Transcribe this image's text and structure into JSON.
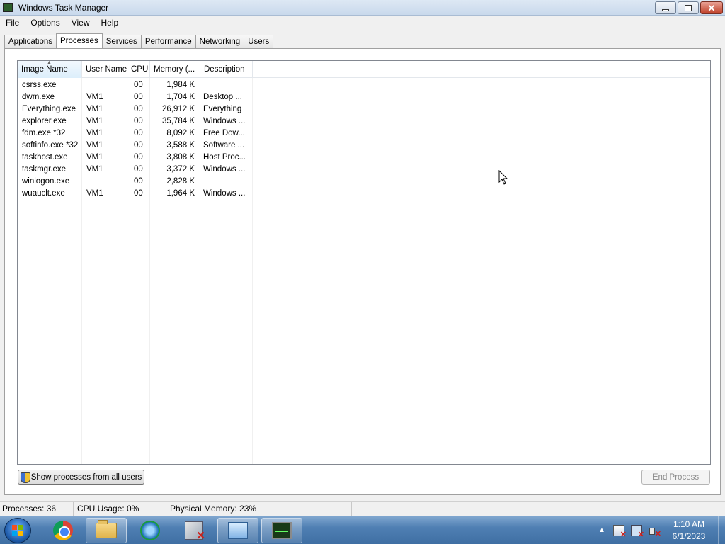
{
  "window": {
    "title": "Windows Task Manager",
    "caption_buttons": {
      "minimize": "",
      "maximize": "",
      "close": "✕"
    }
  },
  "menu": {
    "items": [
      {
        "label": "File"
      },
      {
        "label": "Options"
      },
      {
        "label": "View"
      },
      {
        "label": "Help"
      }
    ]
  },
  "tabs": [
    {
      "label": "Applications",
      "active": false
    },
    {
      "label": "Processes",
      "active": true
    },
    {
      "label": "Services",
      "active": false
    },
    {
      "label": "Performance",
      "active": false
    },
    {
      "label": "Networking",
      "active": false
    },
    {
      "label": "Users",
      "active": false
    }
  ],
  "process_table": {
    "columns": [
      "Image Name",
      "User Name",
      "CPU",
      "Memory (...",
      "Description"
    ],
    "rows": [
      {
        "image": "csrss.exe",
        "user": "",
        "cpu": "00",
        "memory": "1,984 K",
        "description": ""
      },
      {
        "image": "dwm.exe",
        "user": "VM1",
        "cpu": "00",
        "memory": "1,704 K",
        "description": "Desktop ..."
      },
      {
        "image": "Everything.exe",
        "user": "VM1",
        "cpu": "00",
        "memory": "26,912 K",
        "description": "Everything"
      },
      {
        "image": "explorer.exe",
        "user": "VM1",
        "cpu": "00",
        "memory": "35,784 K",
        "description": "Windows ..."
      },
      {
        "image": "fdm.exe *32",
        "user": "VM1",
        "cpu": "00",
        "memory": "8,092 K",
        "description": "Free Dow..."
      },
      {
        "image": "softinfo.exe *32",
        "user": "VM1",
        "cpu": "00",
        "memory": "3,588 K",
        "description": "Software ..."
      },
      {
        "image": "taskhost.exe",
        "user": "VM1",
        "cpu": "00",
        "memory": "3,808 K",
        "description": "Host Proc..."
      },
      {
        "image": "taskmgr.exe",
        "user": "VM1",
        "cpu": "00",
        "memory": "3,372 K",
        "description": "Windows ..."
      },
      {
        "image": "winlogon.exe",
        "user": "",
        "cpu": "00",
        "memory": "2,828 K",
        "description": ""
      },
      {
        "image": "wuauclt.exe",
        "user": "VM1",
        "cpu": "00",
        "memory": "1,964 K",
        "description": "Windows ..."
      }
    ]
  },
  "buttons": {
    "show_all": "Show processes from all users",
    "end_process": "End Process"
  },
  "status": {
    "processes": "Processes: 36",
    "cpu_usage": "CPU Usage: 0%",
    "physical_memory": "Physical Memory: 23%"
  },
  "taskbar": {
    "icons": [
      "windows-logo-icon",
      "chrome-icon",
      "folder-icon",
      "sync-icon",
      "tool-icon",
      "remote-desktop-icon",
      "task-manager-icon"
    ],
    "tray_icons": [
      "action-center-flag-icon",
      "network-icon",
      "volume-muted-icon"
    ],
    "clock_time": "1:10 AM",
    "clock_date": "6/1/2023"
  },
  "colors": {
    "titlebar": "#c9d9ec",
    "taskbar": "#4f7fb3",
    "sorted_header": "#dceefb"
  }
}
